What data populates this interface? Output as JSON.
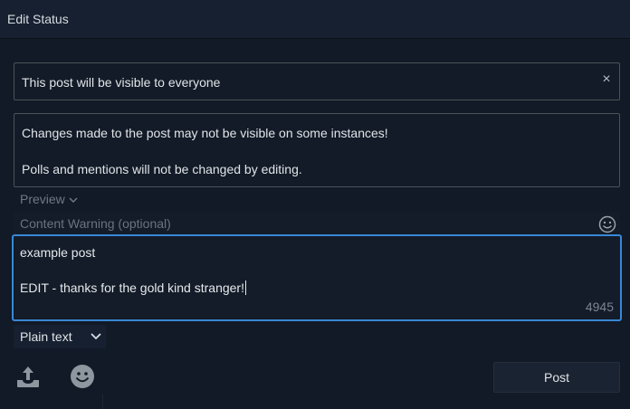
{
  "window": {
    "title": "Edit Status"
  },
  "visibility": {
    "text": "This post will be visible to everyone",
    "close_glyph": "×"
  },
  "notice": {
    "line1": "Changes made to the post may not be visible on some instances!",
    "line2": "Polls and mentions will not be changed by editing."
  },
  "preview": {
    "label": "Preview"
  },
  "content_warning": {
    "placeholder": "Content Warning (optional)"
  },
  "editor": {
    "line1": "example post",
    "line2": "EDIT - thanks for the gold kind stranger!",
    "char_count": "4945"
  },
  "format": {
    "selected": "Plain text"
  },
  "toolbar": {
    "upload_icon": "upload-icon",
    "emoji_icon": "emoji-icon"
  },
  "post_button": {
    "label": "Post"
  },
  "colors": {
    "background": "#121a24",
    "border": "#4a5159",
    "focus": "#3a87d6",
    "muted": "#6f7883"
  }
}
